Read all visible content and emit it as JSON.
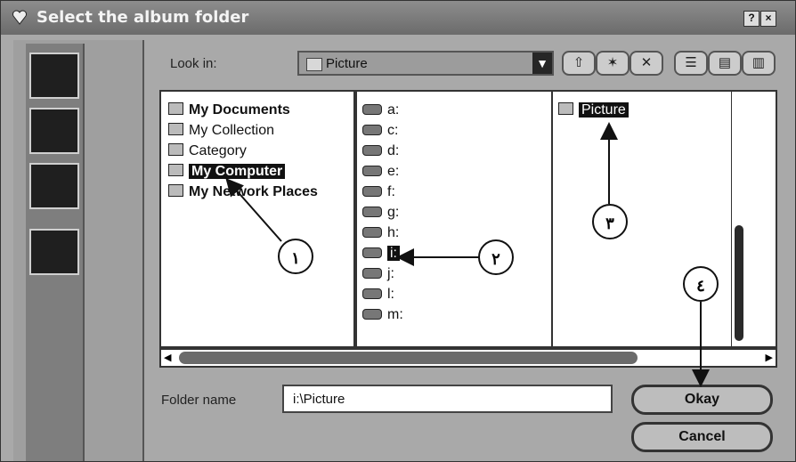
{
  "window": {
    "title": "Select the album folder",
    "help_label": "?",
    "close_label": "×"
  },
  "look_in": {
    "label": "Look in:",
    "value": "Picture"
  },
  "folder_tree": [
    {
      "label": "My Documents",
      "bold": true,
      "selected": false
    },
    {
      "label": "My Collection",
      "bold": false,
      "selected": false
    },
    {
      "label": "Category",
      "bold": false,
      "selected": false
    },
    {
      "label": "My Computer",
      "bold": true,
      "selected": true
    },
    {
      "label": "My Network Places",
      "bold": true,
      "selected": false
    }
  ],
  "drives": [
    "a:",
    "c:",
    "d:",
    "e:",
    "f:",
    "g:",
    "h:",
    "i:",
    "j:",
    "l:",
    "m:"
  ],
  "folders": [
    {
      "label": "Picture",
      "selected": true
    }
  ],
  "folder_name": {
    "label": "Folder name",
    "value": "i:\\Picture"
  },
  "buttons": {
    "okay": "Okay",
    "cancel": "Cancel"
  },
  "callouts": [
    "١",
    "٢",
    "٣",
    "٤"
  ]
}
